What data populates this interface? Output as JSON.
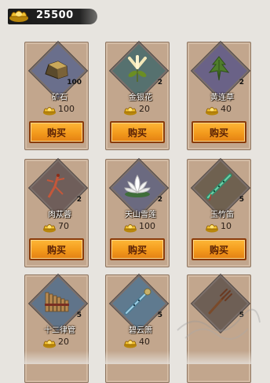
{
  "header": {
    "currency_icon": "gold-ingot-icon",
    "currency_amount": "25500"
  },
  "items": [
    {
      "name": "矿石",
      "qty": "100",
      "price": "100",
      "icon": "ore-icon",
      "bg": "#6a6f8c",
      "buy": "购买"
    },
    {
      "name": "金银花",
      "qty": "2",
      "price": "20",
      "icon": "honeysuckle-icon",
      "bg": "#56716f",
      "buy": "购买"
    },
    {
      "name": "黄连草",
      "qty": "2",
      "price": "40",
      "icon": "coptis-herb-icon",
      "bg": "#6a6287",
      "buy": "购买"
    },
    {
      "name": "肉苁蓉",
      "qty": "2",
      "price": "70",
      "icon": "cistanche-icon",
      "bg": "#6f5e5a",
      "buy": "购买"
    },
    {
      "name": "天山雪莲",
      "qty": "2",
      "price": "100",
      "icon": "snow-lotus-icon",
      "bg": "#6b6a80",
      "buy": "购买"
    },
    {
      "name": "玉竹笛",
      "qty": "5",
      "price": "10",
      "icon": "jade-flute-icon",
      "bg": "#6f6150",
      "buy": "购买"
    },
    {
      "name": "十二律管",
      "qty": "5",
      "price": "20",
      "icon": "panpipe-icon",
      "bg": "#60748a",
      "buy": ""
    },
    {
      "name": "碧云箫",
      "qty": "5",
      "price": "40",
      "icon": "xiao-flute-icon",
      "bg": "#5f7a8f",
      "buy": ""
    },
    {
      "name": "",
      "qty": "5",
      "price": "",
      "icon": "pitchfork-icon",
      "bg": "#6e5f55",
      "buy": ""
    }
  ]
}
